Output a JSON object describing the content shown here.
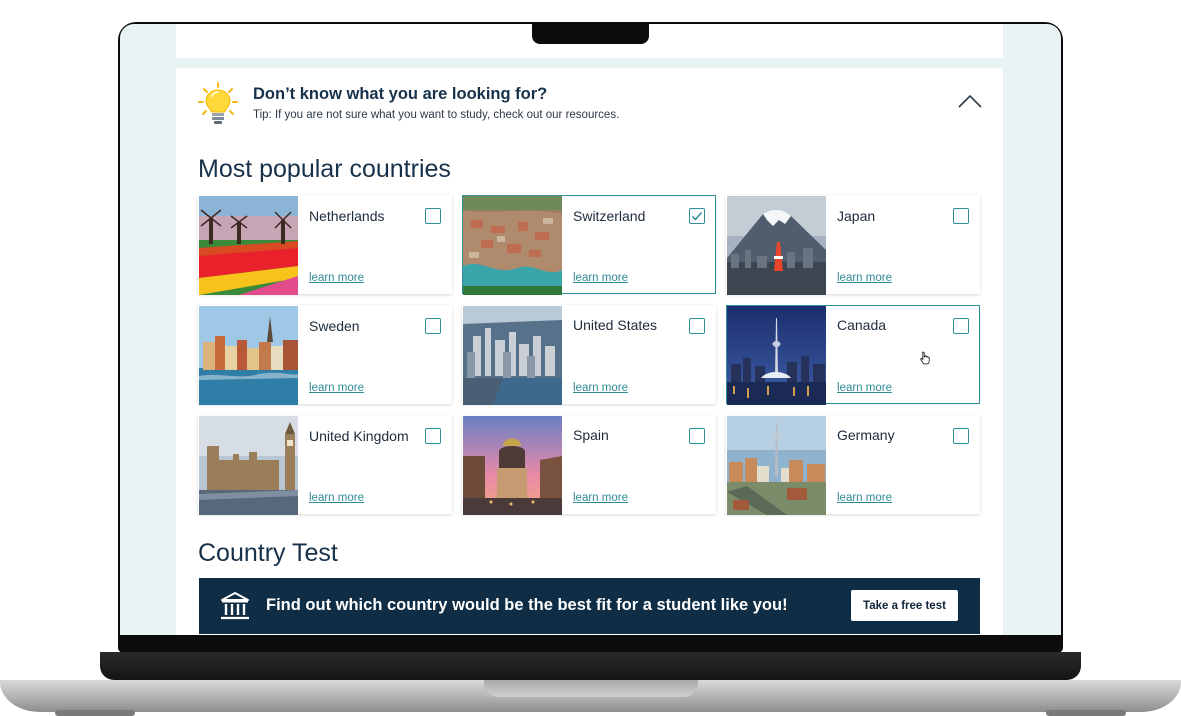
{
  "tip": {
    "title": "Don’t know what you are looking for?",
    "subtitle": "Tip: If you are not sure what you want to study, check out our resources.",
    "icon": "lightbulb-icon",
    "collapse_icon": "chevron-up-icon"
  },
  "popular": {
    "title": "Most popular countries",
    "learn_more": "learn more",
    "countries": [
      {
        "name": "Netherlands",
        "checked": false
      },
      {
        "name": "Switzerland",
        "checked": true
      },
      {
        "name": "Japan",
        "checked": false
      },
      {
        "name": "Sweden",
        "checked": false
      },
      {
        "name": "United States",
        "checked": false
      },
      {
        "name": "Canada",
        "checked": false
      },
      {
        "name": "United Kingdom",
        "checked": false
      },
      {
        "name": "Spain",
        "checked": false
      },
      {
        "name": "Germany",
        "checked": false
      }
    ]
  },
  "test": {
    "title": "Country Test",
    "banner_text": "Find out which country would be the best fit for a student like you!",
    "button_label": "Take a free test",
    "icon": "institution-icon"
  },
  "colors": {
    "accent": "#2f8f98",
    "navy": "#0f2d44",
    "heading": "#17314a"
  }
}
